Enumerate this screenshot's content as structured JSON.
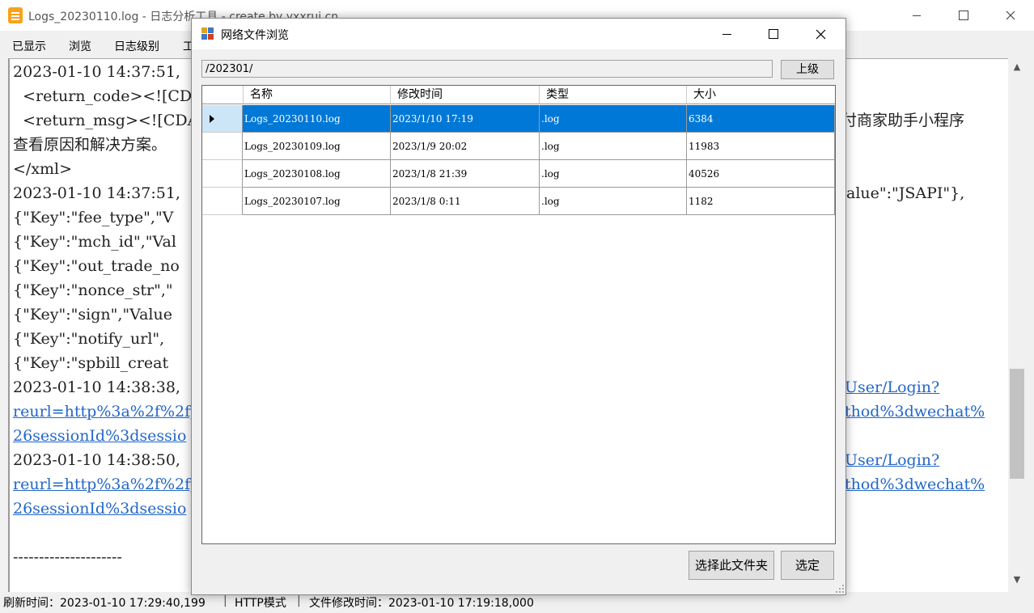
{
  "main_window": {
    "title": "Logs_20230110.log - 日志分析工具 - create by yxxrui.cn",
    "menu": [
      "已显示",
      "浏览",
      "日志级别",
      "工"
    ],
    "log_lines": [
      "2023-01-10 14:37:51,",
      "  <return_code><![CD",
      "  <return_msg><![CDA",
      "查看原因和解决方案。",
      "</xml>",
      "2023-01-10 14:37:51,",
      "{\"Key\":\"fee_type\",\"V",
      "{\"Key\":\"mch_id\",\"Val",
      "{\"Key\":\"out_trade_no",
      "{\"Key\":\"nonce_str\",\"",
      "{\"Key\":\"sign\",\"Value",
      "{\"Key\":\"notify_url\",",
      "{\"Key\":\"spbill_creat",
      "2023-01-10 14:38:38,",
      "reurl=http%3a%2f%2fy",
      "26sessionId%3dsessio",
      "2023-01-10 14:38:50,",
      "reurl=http%3a%2f%2fy",
      "26sessionId%3dsessio",
      "",
      "---------------------"
    ],
    "log_right": {
      "line_2": "付商家助手小程序",
      "line_5": "alue\":\"JSAPI\"},",
      "line_13": "User/Login?",
      "line_14": "thod%3dwechat%",
      "line_16": "User/Login?",
      "line_17": "thod%3dwechat%"
    },
    "status": {
      "refresh": "刷新时间：2023-01-10 17:29:40,199",
      "mode": "HTTP模式",
      "modified": "文件修改时间：2023-01-10 17:19:18,000"
    }
  },
  "dialog": {
    "title": "网络文件浏览",
    "path": "/202301/",
    "up_button": "上级",
    "columns": [
      "名称",
      "修改时间",
      "类型",
      "大小"
    ],
    "rows": [
      {
        "name": "Logs_20230110.log",
        "modified": "2023/1/10 17:19",
        "type": ".log",
        "size": "6384"
      },
      {
        "name": "Logs_20230109.log",
        "modified": "2023/1/9 20:02",
        "type": ".log",
        "size": "11983"
      },
      {
        "name": "Logs_20230108.log",
        "modified": "2023/1/8 21:39",
        "type": ".log",
        "size": "40526"
      },
      {
        "name": "Logs_20230107.log",
        "modified": "2023/1/8 0:11",
        "type": ".log",
        "size": "1182"
      }
    ],
    "selected_row": 0,
    "select_folder_button": "选择此文件夹",
    "confirm_button": "选定"
  },
  "colors": {
    "selection": "#0078d7",
    "link": "#2467c8",
    "app_icon": "#f7a21b"
  }
}
